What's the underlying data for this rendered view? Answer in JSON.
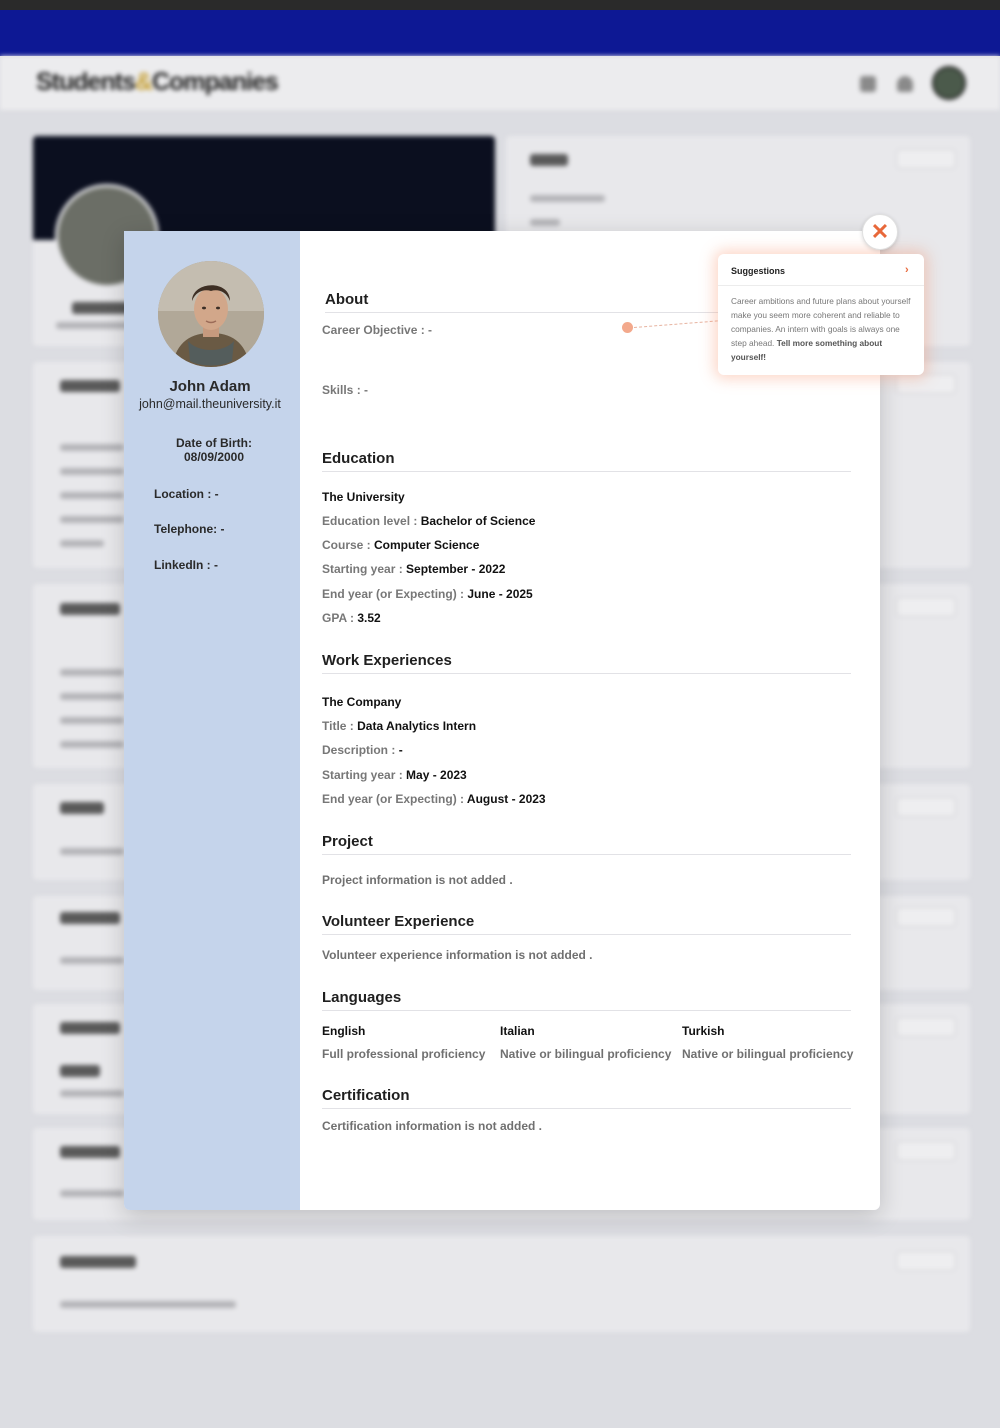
{
  "app": {
    "logo_part1": "Students",
    "logo_amp": "&",
    "logo_part2": "Companies"
  },
  "profile": {
    "name": "John Adam",
    "email": "john@mail.theuniversity.it",
    "dob_label": "Date of Birth:",
    "dob_value": "08/09/2000",
    "location": "Location : -",
    "telephone": "Telephone: -",
    "linkedin": "LinkedIn : -"
  },
  "about": {
    "title": "About",
    "career_objective": "Career Objective : -",
    "skills": "Skills : -"
  },
  "suggestions": {
    "title": "Suggestions",
    "chevron": "›",
    "body": "Career ambitions and future plans about yourself make you seem more coherent and reliable to companies. An intern with goals is always one step ahead.",
    "cta": "Tell more something about yourself!"
  },
  "education": {
    "title": "Education",
    "school": "The University",
    "level_label": "Education level : ",
    "level_value": "Bachelor of Science",
    "course_label": "Course : ",
    "course_value": "Computer Science",
    "start_label": "Starting year : ",
    "start_value": "September - 2022",
    "end_label": "End year (or Expecting) : ",
    "end_value": "June - 2025",
    "gpa_label": "GPA : ",
    "gpa_value": "3.52"
  },
  "work": {
    "title": "Work Experiences",
    "company": "The Company",
    "title_label": "Title : ",
    "title_value": "Data Analytics Intern",
    "desc_label": "Description : ",
    "desc_value": "-",
    "start_label": "Starting year : ",
    "start_value": "May - 2023",
    "end_label": "End year (or Expecting) : ",
    "end_value": "August - 2023"
  },
  "project": {
    "title": "Project",
    "empty": "Project information is not added ."
  },
  "volunteer": {
    "title": "Volunteer Experience",
    "empty": "Volunteer experience information is not added ."
  },
  "languages": {
    "title": "Languages",
    "items": [
      {
        "name": "English",
        "level": "Full professional proficiency"
      },
      {
        "name": "Italian",
        "level": "Native or bilingual proficiency"
      },
      {
        "name": "Turkish",
        "level": "Native or bilingual proficiency"
      }
    ]
  },
  "certification": {
    "title": "Certification",
    "empty": "Certification information is not added ."
  },
  "close": {
    "symbol": "✕"
  },
  "colors": {
    "accent": "#e8683a",
    "sidebar": "#c5d4eb",
    "navbar": "#0d1894"
  }
}
